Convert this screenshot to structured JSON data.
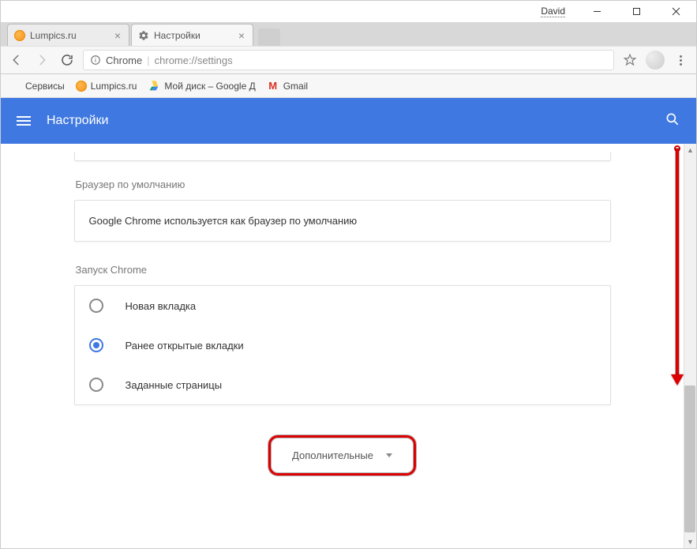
{
  "window": {
    "user": "David"
  },
  "tabs": [
    {
      "label": "Lumpics.ru"
    },
    {
      "label": "Настройки"
    }
  ],
  "omnibox": {
    "origin": "Chrome",
    "url": "chrome://settings"
  },
  "bookmarks": {
    "apps": "Сервисы",
    "items": [
      {
        "label": "Lumpics.ru"
      },
      {
        "label": "Мой диск – Google Д"
      },
      {
        "label": "Gmail"
      }
    ]
  },
  "header": {
    "title": "Настройки"
  },
  "sections": {
    "default_browser": {
      "title": "Браузер по умолчанию",
      "text": "Google Chrome используется как браузер по умолчанию"
    },
    "startup": {
      "title": "Запуск Chrome",
      "options": [
        {
          "label": "Новая вкладка",
          "selected": false
        },
        {
          "label": "Ранее открытые вкладки",
          "selected": true
        },
        {
          "label": "Заданные страницы",
          "selected": false
        }
      ]
    }
  },
  "advanced": {
    "label": "Дополнительные"
  }
}
